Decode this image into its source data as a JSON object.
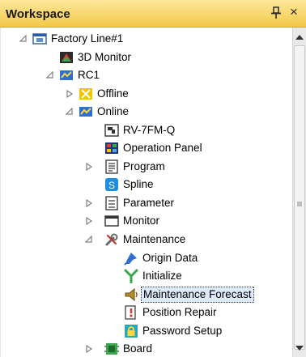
{
  "panel": {
    "title": "Workspace",
    "pin_glyph": "⊥",
    "close_glyph": "×"
  },
  "icons": {
    "arrow_color": "#808080",
    "selected_bg": "#dceafc"
  },
  "tree": [
    {
      "label": "Factory Line#1",
      "state": "expanded",
      "icon": "workspace-icon"
    },
    {
      "label": "3D Monitor",
      "state": "leaf",
      "icon": "3d-monitor-icon"
    },
    {
      "label": "RC1",
      "state": "expanded",
      "icon": "robot-controller-icon"
    },
    {
      "label": "Offline",
      "state": "collapsed",
      "icon": "offline-icon"
    },
    {
      "label": "Online",
      "state": "expanded",
      "icon": "online-icon"
    },
    {
      "label": "RV-7FM-Q",
      "state": "leaf",
      "icon": "robot-model-icon"
    },
    {
      "label": "Operation Panel",
      "state": "leaf",
      "icon": "operation-panel-icon"
    },
    {
      "label": "Program",
      "state": "collapsed",
      "icon": "program-icon"
    },
    {
      "label": "Spline",
      "state": "leaf",
      "icon": "spline-icon"
    },
    {
      "label": "Parameter",
      "state": "collapsed",
      "icon": "parameter-icon"
    },
    {
      "label": "Monitor",
      "state": "collapsed",
      "icon": "monitor-icon"
    },
    {
      "label": "Maintenance",
      "state": "expanded",
      "icon": "maintenance-icon"
    },
    {
      "label": "Origin Data",
      "state": "leaf",
      "icon": "origin-data-icon"
    },
    {
      "label": "Initialize",
      "state": "leaf",
      "icon": "initialize-icon"
    },
    {
      "label": "Maintenance Forecast",
      "state": "selected",
      "icon": "maintenance-forecast-icon"
    },
    {
      "label": "Position Repair",
      "state": "leaf",
      "icon": "position-repair-icon"
    },
    {
      "label": "Password Setup",
      "state": "leaf",
      "icon": "password-setup-icon"
    },
    {
      "label": "Board",
      "state": "collapsed",
      "icon": "board-icon"
    }
  ]
}
